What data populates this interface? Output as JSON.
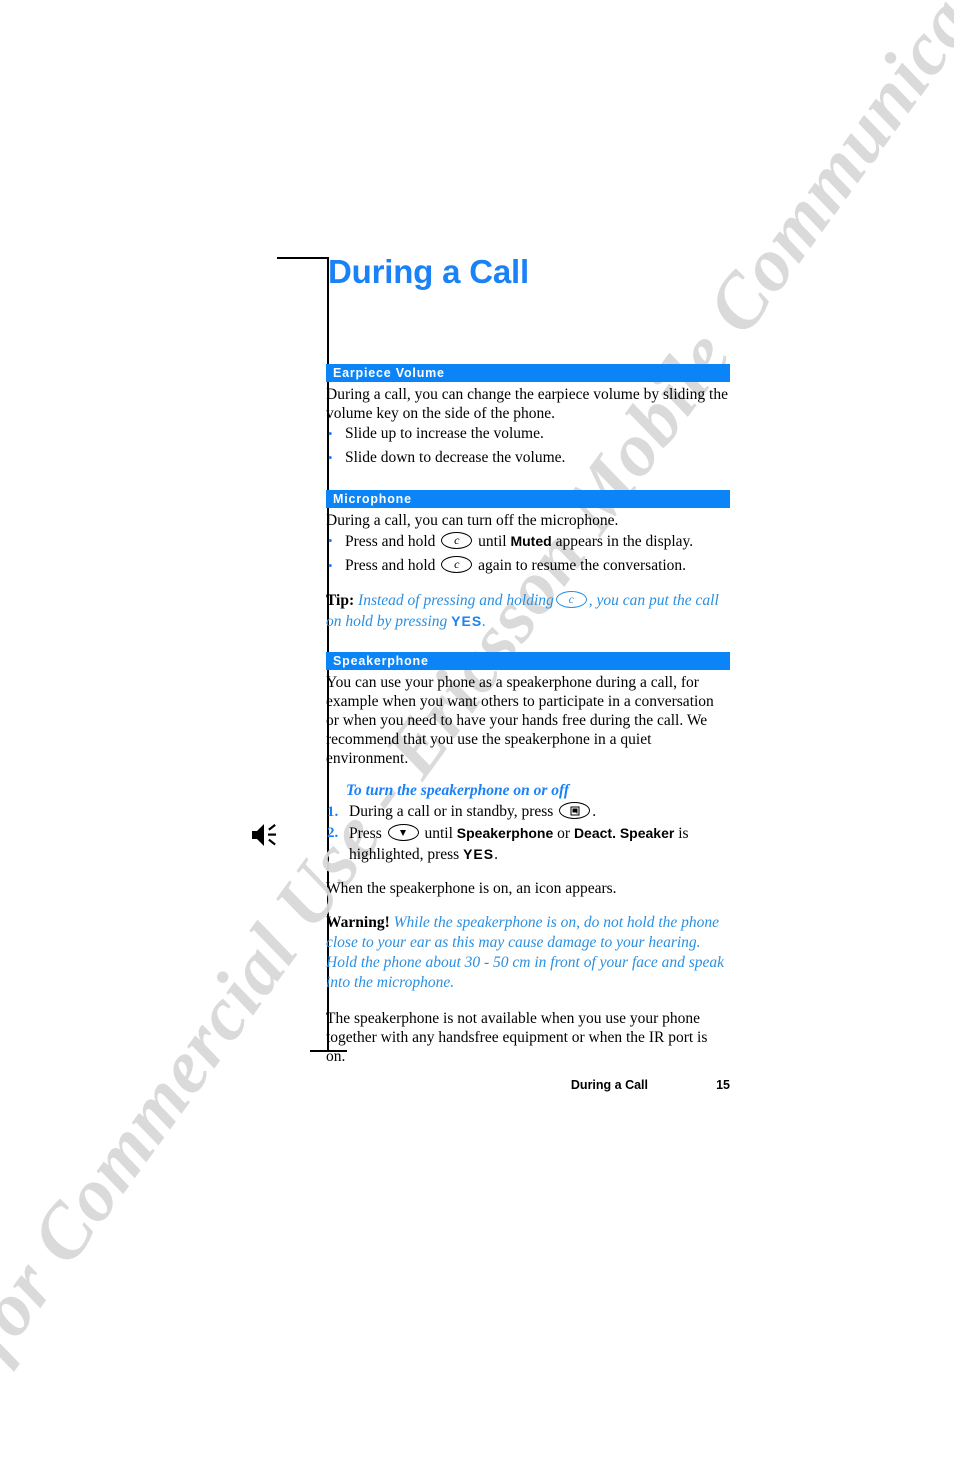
{
  "document": {
    "title": "During a Call",
    "watermark": "Not for Commercial Use - Ericsson Mobile Communications AB",
    "accent_blue": "#1a82f7",
    "bar_blue": "#0a84f7",
    "italic_blue": "#2a8fe0"
  },
  "margin_icon": {
    "name": "speakerphone-icon",
    "label": "speakerphone"
  },
  "sections": [
    {
      "id": "earpiece-volume",
      "heading": "Earpiece Volume",
      "intro": "During a call, you can change the earpiece volume by sliding the volume key on the side of the phone.",
      "bullets": [
        "Slide up to increase the volume.",
        "Slide down to decrease the volume."
      ]
    },
    {
      "id": "microphone",
      "heading": "Microphone",
      "intro": "During a call, you can turn off the microphone.",
      "bullets": [
        {
          "pre": "Press and hold",
          "key": "c",
          "mid": "until",
          "bold": "Muted",
          "post": "appears in the display."
        },
        {
          "pre": "Press and hold",
          "key": "c",
          "post": "again to resume the conversation."
        }
      ],
      "tip": {
        "lead": "Tip:",
        "part1": "Instead of pressing and holding",
        "key": "c",
        "part2": ", you can put the call on hold by pressing",
        "key_label": "YES",
        "part3": "."
      }
    },
    {
      "id": "speakerphone",
      "heading": "Speakerphone",
      "intro": "You can use your phone as a speakerphone during a call, for example when you want others to participate in a conversation or when you need to have your hands free during the call. We recommend that you use the speakerphone in a quiet environment.",
      "subhead": "To turn the speakerphone on or off",
      "steps": [
        {
          "num": "1.",
          "pre": "During a call or in standby, press",
          "key": "menu",
          "post": "."
        },
        {
          "num": "2.",
          "pre": "Press",
          "key": "down-arrow",
          "mid": "until",
          "bold1": "Speakerphone",
          "or": "or",
          "bold2": "Deact. Speaker",
          "post": "is highlighted, press",
          "key_label": "YES",
          "end": "."
        }
      ],
      "note": "When the speakerphone is on, an icon appears.",
      "warning": {
        "lead": "Warning!",
        "body": "While the speakerphone is on, do not hold the phone close to your ear as this may cause damage to your hearing. Hold the phone about 30 - 50 cm in front of your face and speak into the microphone."
      },
      "closing": "The speakerphone is not available when you use your phone together with any handsfree equipment or when the IR port is on."
    }
  ],
  "footer": {
    "chapter": "During a Call",
    "page_number": "15"
  }
}
